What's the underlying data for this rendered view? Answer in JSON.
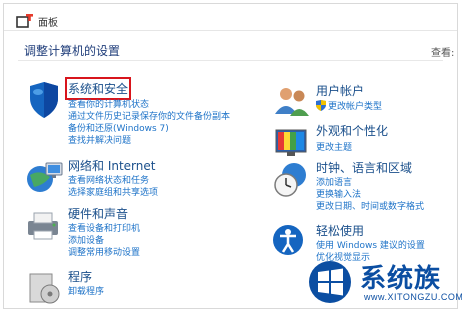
{
  "window": {
    "title": "面板"
  },
  "header": {
    "heading": "调整计算机的设置",
    "view_by": "查看:"
  },
  "categories": [
    {
      "title": "系统和安全",
      "links": [
        "查看你的计算机状态",
        "通过文件历史记录保存你的文件备份副本",
        "备份和还原(Windows 7)",
        "查找并解决问题"
      ]
    },
    {
      "title": "网络和 Internet",
      "links": [
        "查看网络状态和任务",
        "选择家庭组和共享选项"
      ]
    },
    {
      "title": "硬件和声音",
      "links": [
        "查看设备和打印机",
        "添加设备",
        "调整常用移动设置"
      ]
    },
    {
      "title": "程序",
      "links": [
        "卸载程序"
      ]
    },
    {
      "title": "用户帐户",
      "links": [
        "更改帐户类型"
      ]
    },
    {
      "title": "外观和个性化",
      "links": [
        "更改主题"
      ]
    },
    {
      "title": "时钟、语言和区域",
      "links": [
        "添加语言",
        "更换输入法",
        "更改日期、时间或数字格式"
      ]
    },
    {
      "title": "轻松使用",
      "links": [
        "使用 Windows 建议的设置",
        "优化视觉显示"
      ]
    }
  ],
  "watermark": {
    "name": "系统族",
    "url": "www.XITONGZU.COM"
  }
}
